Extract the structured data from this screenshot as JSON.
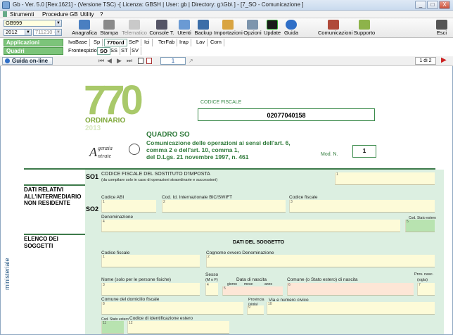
{
  "window": {
    "title": "Gb - Ver. 5.0 [Rev.1621] - (Versione TSC) -[ Licenza: GBSH | User: gb | Directory: g:\\Gb\\ ] - [7_SO - Comunicazione ]",
    "min": "_",
    "max": "□",
    "close": "X"
  },
  "menu": [
    "Strumenti",
    "Procedure GB",
    "Utility",
    "?"
  ],
  "toolbar": {
    "left_select": "GB999",
    "year": "2012",
    "code": "711210 -",
    "applicazioni": "Applicazioni",
    "quadri": "Quadri",
    "buttons": [
      "Anagrafica",
      "Stampa",
      "Telematico",
      "Console T.",
      "Utenti",
      "Backup",
      "Importazioni",
      "Opzioni",
      "Update",
      "Guida",
      "Comunicazioni",
      "Supporto",
      "Esci"
    ]
  },
  "tabs1": [
    "IvaBase",
    "Sp",
    "770ord",
    "SeP",
    "Ici",
    "TerFab",
    "Irap",
    "Lav",
    "Com"
  ],
  "tabs2": [
    "Frontespizio",
    "SO",
    "SS",
    "ST",
    "SV"
  ],
  "nav": {
    "help": "Guida on-line",
    "page": "1",
    "pages": "1 di 2"
  },
  "form": {
    "logo_num": "770",
    "logo_title": "ORDINARIO",
    "logo_year": "2013",
    "agency1": "genzia",
    "agency2": "ntrate",
    "cf_label": "CODICE FISCALE",
    "cf_value": "02077040158",
    "quadro": "QUADRO SO",
    "desc": [
      "Comunicazione delle operazioni ai sensi dell'art. 6,",
      "comma 2 e dell'art. 10, comma 1,",
      "del D.Lgs. 21 novembre 1997, n. 461"
    ],
    "modn_label": "Mod. N.",
    "modn": "1",
    "so1": "SO1",
    "so1_title": "CODICE FISCALE DEL SOSTITUTO D'IMPOSTA",
    "so1_sub": "(da compilare solo in caso di operazioni straordinarie e successioni)",
    "sect2": [
      "DATI RELATIVI",
      "ALL'INTERMEDIARIO",
      "NON RESIDENTE"
    ],
    "so2": "SO2",
    "abi": "Codice ABI",
    "bic": "Cod. Id. Internazionale BIC/SWIFT",
    "cf2": "Codice fiscale",
    "denom": "Denominazione",
    "stato_estero": "Cod. Stato estero",
    "sect3": [
      "ELENCO DEI",
      "SOGGETTI"
    ],
    "dati_soggetto": "DATI DEL SOGGETTO",
    "cf3": "Codice fiscale",
    "cognome": "Cognome ovvero Denominazione",
    "nome": "Nome (solo per le persone fisiche)",
    "sesso": "Sesso",
    "sesso_sub": "(M o F)",
    "nascita": "Data di nascita",
    "giorno": "giorno",
    "mese": "mese",
    "anno": "anno",
    "comune_nascita": "Comune (o Stato estero) di nascita",
    "prov": "Prov. nasc.",
    "prov_sub": "(sigla)",
    "comune_dom": "Comune del domicilio fiscale",
    "provincia": "Provincia",
    "provincia_sub": "(sigla)",
    "via": "Via e numero civico",
    "stato_est2": "Cod. Stato estero",
    "id_estero": "Codice di identificazione estero",
    "side": "ministeriale"
  }
}
